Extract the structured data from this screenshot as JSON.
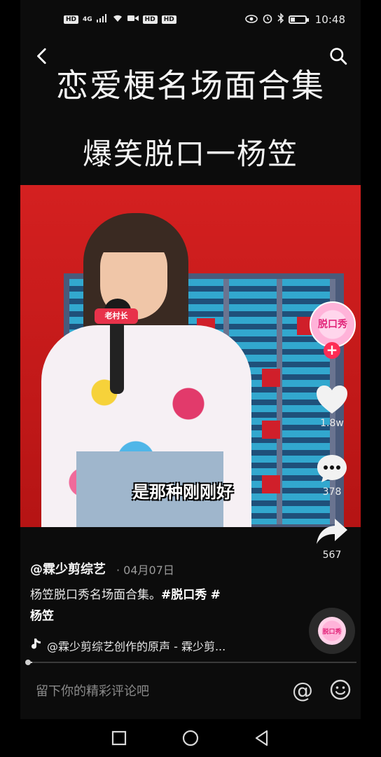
{
  "status_bar": {
    "left_labels": [
      "HD",
      "4G",
      "HD",
      "HD"
    ],
    "time": "10:48"
  },
  "header": {
    "title_line1": "恋爱梗名场面合集",
    "title_line2": "爆笑脱口一杨笠"
  },
  "video": {
    "mic_flag": "老村长",
    "subtitle": "是那种刚刚好"
  },
  "creator_avatar": {
    "text": "脱口秀"
  },
  "actions": {
    "likes": "1.8w",
    "comments": "378",
    "shares": "567"
  },
  "post": {
    "author": "@霖少剪综艺",
    "date": "· 04月07日",
    "description": "杨笠脱口秀名场面合集。",
    "hashtag1": "#脱口秀",
    "hashtag2": "#",
    "hashtag2_line2": "杨笠",
    "music": "@霖少剪综艺创作的原声 - 霖少剪...",
    "progress": 0.02
  },
  "comment_bar": {
    "placeholder": "留下你的精彩评论吧",
    "at_symbol": "@"
  },
  "icons": [
    "back-icon",
    "search-icon",
    "heart-icon",
    "comment-icon",
    "share-icon",
    "music-note-icon",
    "emoji-icon",
    "square-icon",
    "circle-icon",
    "triangle-back-icon"
  ]
}
